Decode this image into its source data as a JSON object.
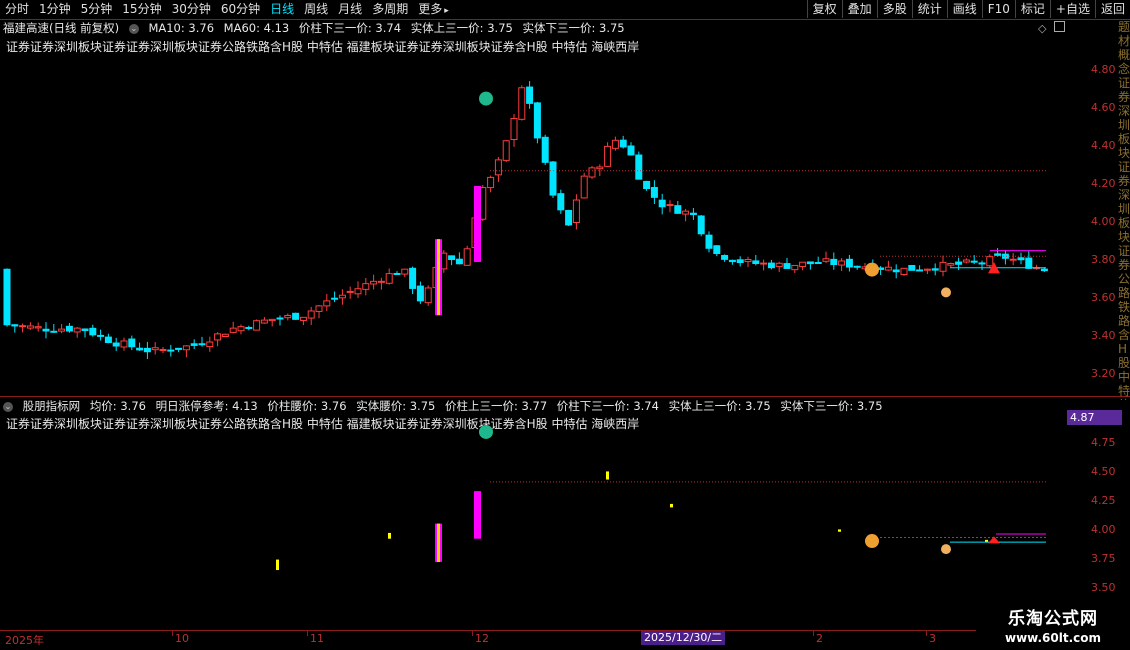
{
  "toolbar": {
    "periods": [
      "分时",
      "1分钟",
      "5分钟",
      "15分钟",
      "30分钟",
      "60分钟",
      "日线",
      "周线",
      "月线",
      "多周期",
      "更多"
    ],
    "active_period": "日线",
    "more_arrow": "▸",
    "buttons": [
      "复权",
      "叠加",
      "多股",
      "统计",
      "画线",
      "F10",
      "标记",
      "+自选",
      "返回"
    ]
  },
  "main_panel": {
    "title": "福建高速(日线 前复权)",
    "ma10": "MA10: 3.76",
    "ma60": "MA60: 4.13",
    "v1": "价柱下三一价: 3.74",
    "v2": "实体上三一价: 3.75",
    "v3": "实体下三一价: 3.75",
    "tags": "证券证券深圳板块证券证券深圳板块证券公路铁路含H股 中特估 福建板块证券证券深圳板块证券含H股 中特估 海峡西岸",
    "axis_ticks": [
      "4.80",
      "4.60",
      "4.40",
      "4.20",
      "4.00",
      "3.80",
      "3.60",
      "3.40",
      "3.20"
    ]
  },
  "sub_panel": {
    "title": "股朋指标网",
    "v0": "均价: 3.76",
    "v1": "明日涨停参考: 4.13",
    "v2": "价柱腰价: 3.76",
    "v3": "实体腰价: 3.75",
    "v4": "价柱上三一价: 3.77",
    "v5": "价柱下三一价: 3.74",
    "v6": "实体上三一价: 3.75",
    "v7": "实体下三一价: 3.75",
    "tags": "证券证券深圳板块证券证券深圳板块证券公路铁路含H股 中特估 福建板块证券证券深圳板块证券含H股 中特估 海峡西岸",
    "axis_ticks": [
      "4.75",
      "4.50",
      "4.25",
      "4.00",
      "3.75",
      "3.50"
    ],
    "price_tag": "4.87"
  },
  "date_axis": {
    "labels": [
      "2025年",
      "10",
      "11",
      "12",
      "2",
      "3"
    ],
    "cursor_date": "2025/12/30/二"
  },
  "side_text": "题材概念证券深圳板块证券深圳板块证券公路铁路含H股中特估福建板块海峡西岸",
  "watermark": {
    "line1": "乐淘公式网",
    "line2": "www.60lt.com"
  },
  "colors": {
    "up": "#ff3c3c",
    "down": "#00e5ff",
    "accent": "#ff00ff",
    "yellow": "#ffff00"
  }
}
